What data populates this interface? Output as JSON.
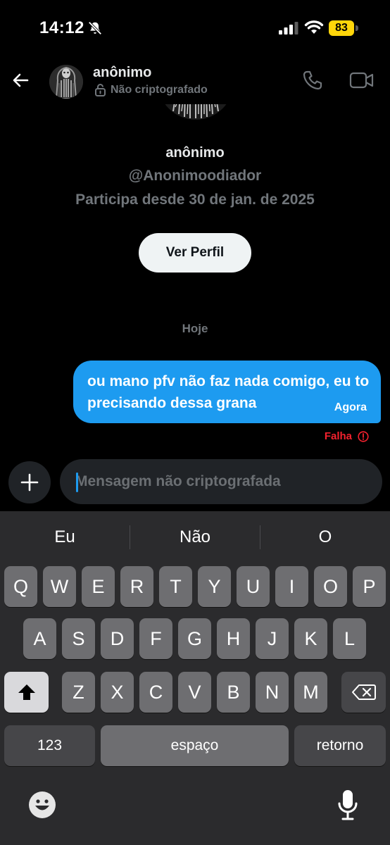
{
  "status_bar": {
    "time": "14:12",
    "battery": "83"
  },
  "header": {
    "name": "anônimo",
    "encryption_status": "Não criptografado"
  },
  "profile": {
    "name": "anônimo",
    "handle": "@Anonimoodiador",
    "joined": "Participa desde 30 de jan. de 2025",
    "view_profile_label": "Ver Perfil"
  },
  "conversation": {
    "date_separator": "Hoje",
    "messages": [
      {
        "text": "ou mano pfv não faz nada comigo, eu to precisando dessa grana",
        "time": "Agora",
        "status": "Falha"
      }
    ]
  },
  "composer": {
    "placeholder": "Mensagem não criptografada"
  },
  "keyboard": {
    "suggestions": [
      "Eu",
      "Não",
      "O"
    ],
    "row1": [
      "Q",
      "W",
      "E",
      "R",
      "T",
      "Y",
      "U",
      "I",
      "O",
      "P"
    ],
    "row2": [
      "A",
      "S",
      "D",
      "F",
      "G",
      "H",
      "J",
      "K",
      "L"
    ],
    "row3": [
      "Z",
      "X",
      "C",
      "V",
      "B",
      "N",
      "M"
    ],
    "numbers_label": "123",
    "space_label": "espaço",
    "return_label": "retorno"
  },
  "colors": {
    "accent": "#1d9bf0",
    "error": "#f4212e",
    "battery": "#ffd60a"
  }
}
